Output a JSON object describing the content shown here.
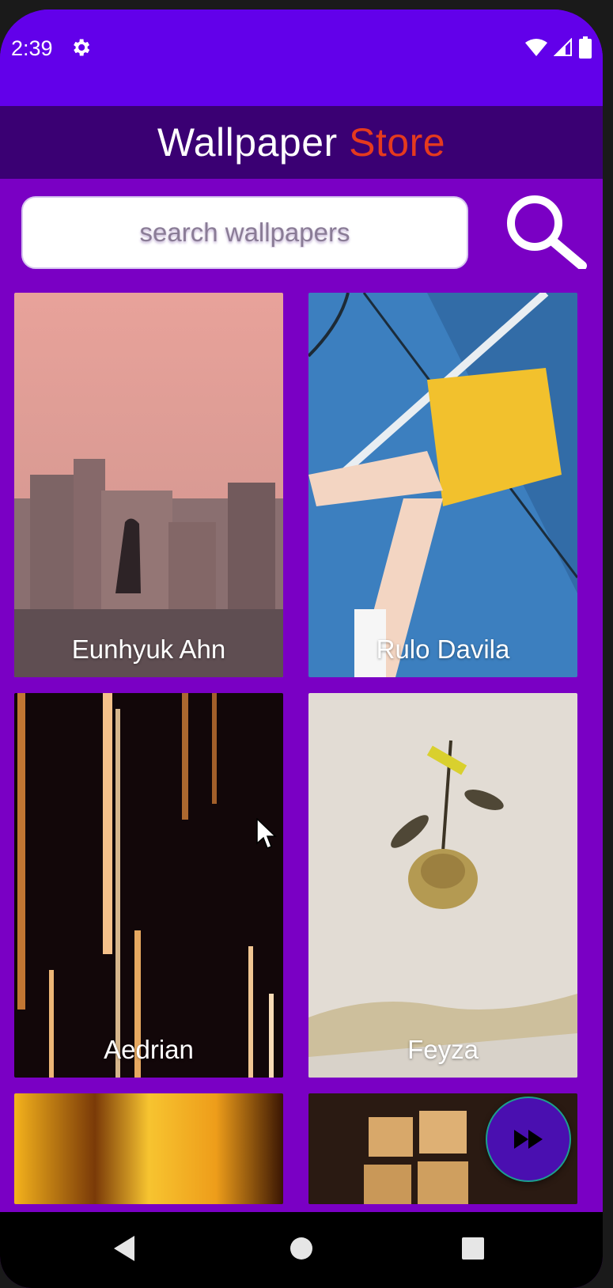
{
  "status": {
    "time": "2:39",
    "gear_icon": "gear-icon",
    "wifi_icon": "wifi-icon",
    "signal_icon": "signal-icon",
    "battery_icon": "battery-icon"
  },
  "app": {
    "title_main": "Wallpaper",
    "title_accent": "Store",
    "colors": {
      "status_bar": "#6200ea",
      "app_bar": "#3a0073",
      "background": "#7a00c4",
      "accent": "#e53a1e"
    }
  },
  "search": {
    "placeholder": "search wallpapers",
    "icon": "search-icon"
  },
  "wallpapers": [
    {
      "author": "Eunhyuk Ahn"
    },
    {
      "author": "Rulo Davila"
    },
    {
      "author": "Aedrian"
    },
    {
      "author": "Feyza"
    },
    {
      "author": ""
    },
    {
      "author": ""
    }
  ],
  "fab": {
    "icon": "fast-forward-icon"
  },
  "nav": {
    "back_icon": "back-icon",
    "home_icon": "home-icon",
    "recents_icon": "recents-icon"
  }
}
